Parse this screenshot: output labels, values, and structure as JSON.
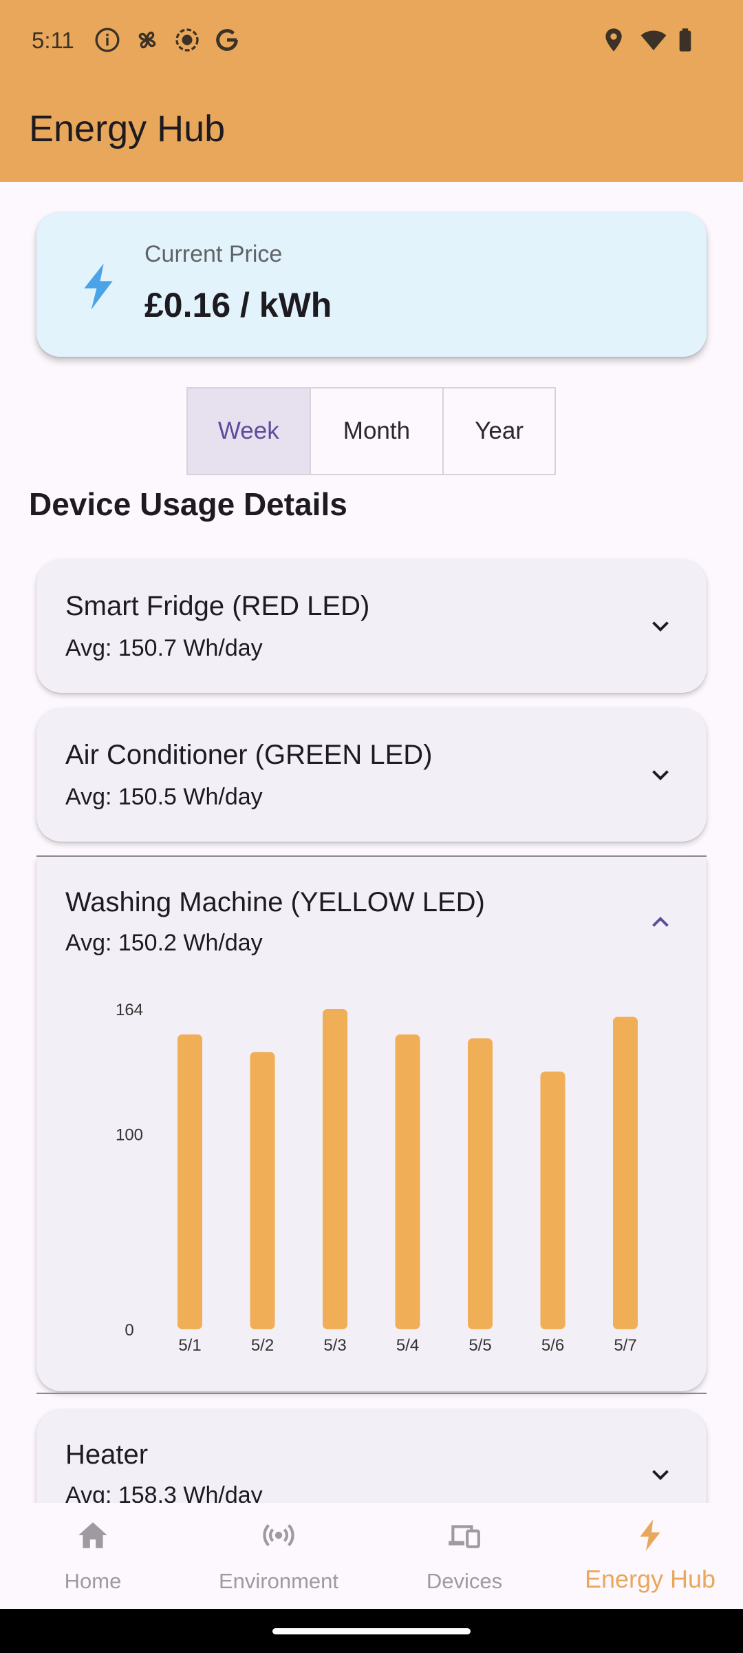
{
  "status_bar": {
    "time": "5:11",
    "left_icons": [
      "info-icon",
      "fan-icon",
      "record-icon",
      "google-icon"
    ],
    "right_icons": [
      "location-icon",
      "wifi-icon",
      "battery-icon"
    ]
  },
  "app_bar": {
    "title": "Energy Hub",
    "color": "#e8a75b"
  },
  "price_card": {
    "icon": "lightning-bolt-icon",
    "label": "Current Price",
    "value": "£0.16 / kWh"
  },
  "period_selector": {
    "options": [
      "Week",
      "Month",
      "Year"
    ],
    "selected": "Week"
  },
  "section_title": "Device Usage Details",
  "devices": [
    {
      "name": "Smart Fridge (RED LED)",
      "avg": "Avg: 150.7 Wh/day",
      "expanded": false
    },
    {
      "name": "Air Conditioner (GREEN LED)",
      "avg": "Avg: 150.5 Wh/day",
      "expanded": false
    },
    {
      "name": "Washing Machine (YELLOW LED)",
      "avg": "Avg: 150.2 Wh/day",
      "expanded": true
    },
    {
      "name": "Heater",
      "avg": "Avg: 158.3 Wh/day",
      "expanded": false
    }
  ],
  "chart_data": {
    "type": "bar",
    "categories": [
      "5/1",
      "5/2",
      "5/3",
      "5/4",
      "5/5",
      "5/6",
      "5/7"
    ],
    "values": [
      151,
      142,
      164,
      151,
      149,
      132,
      160
    ],
    "y_ticks": [
      "0",
      "100",
      "164"
    ],
    "ylim": [
      0,
      164
    ],
    "bar_color": "#f0ae57",
    "grid": false
  },
  "bottom_nav": {
    "items": [
      {
        "label": "Home",
        "icon": "home-icon"
      },
      {
        "label": "Environment",
        "icon": "broadcast-icon"
      },
      {
        "label": "Devices",
        "icon": "devices-icon"
      },
      {
        "label": "Energy Hub",
        "icon": "lightning-bolt-icon"
      }
    ],
    "active": "Energy Hub",
    "active_color": "#e8a75b",
    "inactive_color": "#9e9aa2"
  }
}
